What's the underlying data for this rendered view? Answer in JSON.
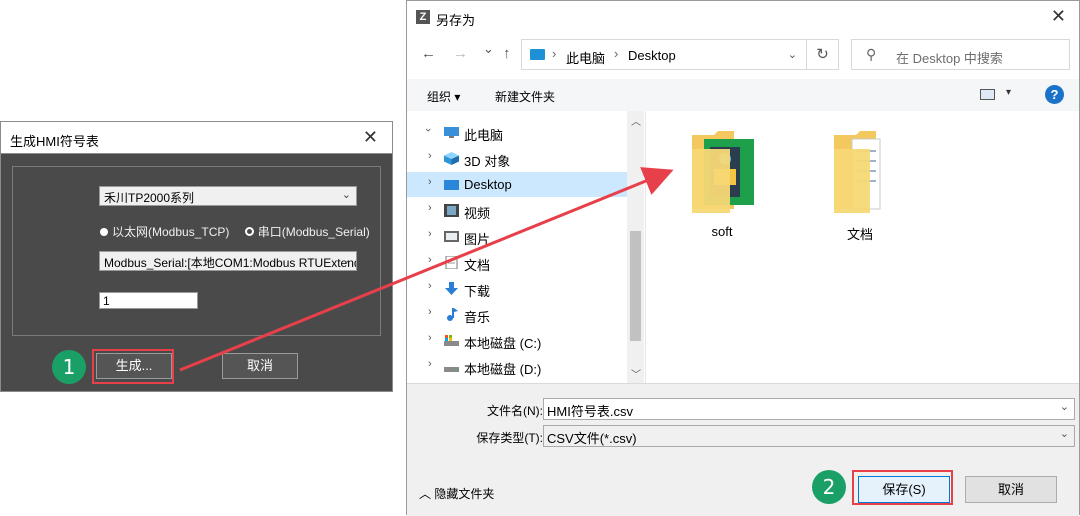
{
  "hmi_dialog": {
    "title": "生成HMI符号表",
    "close_glyph": "✕",
    "series_select": "禾川TP2000系列",
    "radio_ethernet": "以太网(Modbus_TCP)",
    "radio_serial": "串口(Modbus_Serial)",
    "connection_select": "Modbus_Serial:[本地COM1:Modbus RTUExtend",
    "number_value": "1",
    "generate_button": "生成...",
    "cancel_button": "取消"
  },
  "save_dialog": {
    "title": "另存为",
    "logo_glyph": "Z",
    "close_glyph": "✕",
    "nav": {
      "back": "←",
      "forward": "→",
      "history": "⌄",
      "up": "↑",
      "refresh": "↻"
    },
    "address": {
      "crumbs": [
        "此电脑",
        "Desktop"
      ],
      "separator": "›"
    },
    "search_placeholder": "在 Desktop 中搜索",
    "toolbar": {
      "organize": "组织 ▾",
      "new_folder": "新建文件夹",
      "view_dropdown": "▾",
      "help": "?"
    },
    "tree": [
      {
        "label": "此电脑",
        "icon": "computer-icon",
        "expanded": true
      },
      {
        "label": "3D 对象",
        "icon": "3d-objects-icon"
      },
      {
        "label": "Desktop",
        "icon": "desktop-icon",
        "selected": true
      },
      {
        "label": "视频",
        "icon": "video-icon"
      },
      {
        "label": "图片",
        "icon": "pictures-icon"
      },
      {
        "label": "文档",
        "icon": "documents-icon"
      },
      {
        "label": "下载",
        "icon": "download-icon"
      },
      {
        "label": "音乐",
        "icon": "music-icon"
      },
      {
        "label": "本地磁盘 (C:)",
        "icon": "drive-c-icon"
      },
      {
        "label": "本地磁盘 (D:)",
        "icon": "drive-d-icon"
      }
    ],
    "files": [
      {
        "label": "soft",
        "icon": "folder-icon"
      },
      {
        "label": "文档",
        "icon": "folder-icon"
      }
    ],
    "filename_label": "文件名(N):",
    "filename_value": "HMI符号表.csv",
    "filetype_label": "保存类型(T):",
    "filetype_value": "CSV文件(*.csv)",
    "hide_folders": "隐藏文件夹",
    "save_button": "保存(S)",
    "cancel_button": "取消"
  },
  "annotations": {
    "step1": "1",
    "step2": "2",
    "highlight_color": "#e8404a",
    "badge_color": "#1aa067"
  }
}
